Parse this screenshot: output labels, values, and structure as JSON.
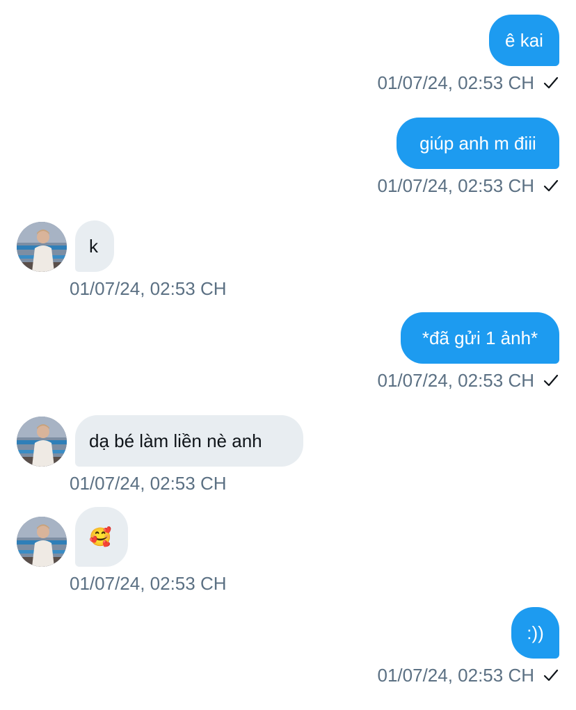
{
  "colors": {
    "sent_bubble": "#1d9bf0",
    "received_bubble": "#e8edf1",
    "timestamp": "#5b7083"
  },
  "messages": [
    {
      "direction": "sent",
      "text": "ê kai",
      "time": "01/07/24, 02:53 CH",
      "status_icon": "checkmark-icon"
    },
    {
      "direction": "sent",
      "text": "giúp anh m điii",
      "time": "01/07/24, 02:53 CH",
      "status_icon": "checkmark-icon"
    },
    {
      "direction": "received",
      "text": "k",
      "time": "01/07/24, 02:53 CH",
      "avatar_icon": "avatar"
    },
    {
      "direction": "sent",
      "text": "*đã gửi 1 ảnh*",
      "time": "01/07/24, 02:53 CH",
      "status_icon": "checkmark-icon"
    },
    {
      "direction": "received",
      "text": "dạ bé làm liền nè anh",
      "time": "01/07/24, 02:53 CH",
      "avatar_icon": "avatar"
    },
    {
      "direction": "received",
      "text": "🥰",
      "time": "01/07/24, 02:53 CH",
      "avatar_icon": "avatar"
    },
    {
      "direction": "sent",
      "text": ":))",
      "time": "01/07/24, 02:53 CH",
      "status_icon": "checkmark-icon"
    }
  ]
}
